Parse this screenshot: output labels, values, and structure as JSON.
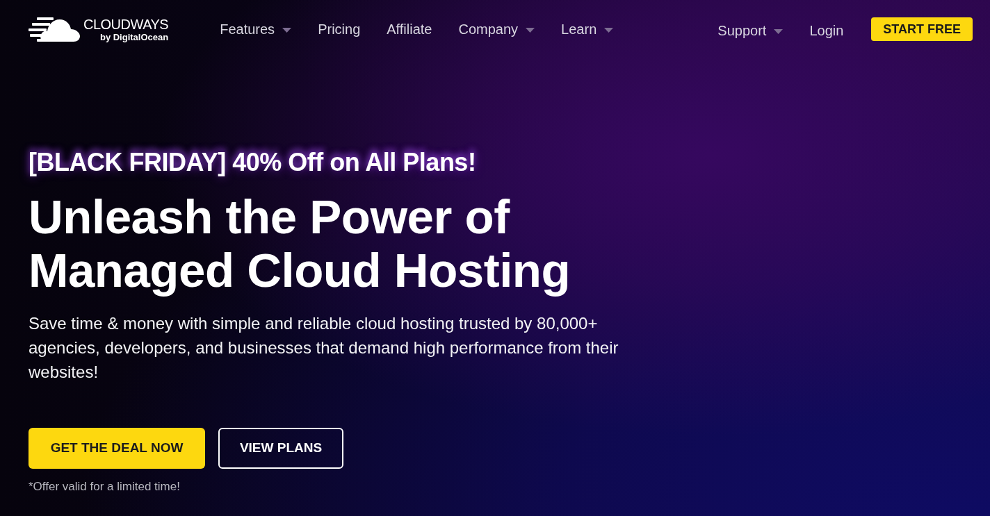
{
  "logo": {
    "name": "CLOUDWAYS",
    "byline": "by DigitalOcean"
  },
  "nav": {
    "items": [
      {
        "label": "Features",
        "kind": "dropdown"
      },
      {
        "label": "Pricing",
        "kind": "link"
      },
      {
        "label": "Affiliate",
        "kind": "link"
      },
      {
        "label": "Company",
        "kind": "dropdown"
      },
      {
        "label": "Learn",
        "kind": "dropdown"
      }
    ],
    "right_items": [
      {
        "label": "Support",
        "kind": "dropdown"
      },
      {
        "label": "Login",
        "kind": "link"
      }
    ],
    "cta": "START FREE"
  },
  "hero": {
    "promo": "[BLACK FRIDAY] 40% Off on All Plans!",
    "headline": [
      "Unleash the Power of",
      "Managed Cloud Hosting"
    ],
    "description": "Save time & money with simple and reliable cloud hosting trusted by 80,000+ agencies, developers, and businesses that demand high performance from their websites!",
    "buttons": [
      {
        "label": "GET THE DEAL NOW",
        "kind": "primary"
      },
      {
        "label": "VIEW PLANS",
        "kind": "outline"
      }
    ],
    "note": "*Offer valid for a limited time!"
  }
}
